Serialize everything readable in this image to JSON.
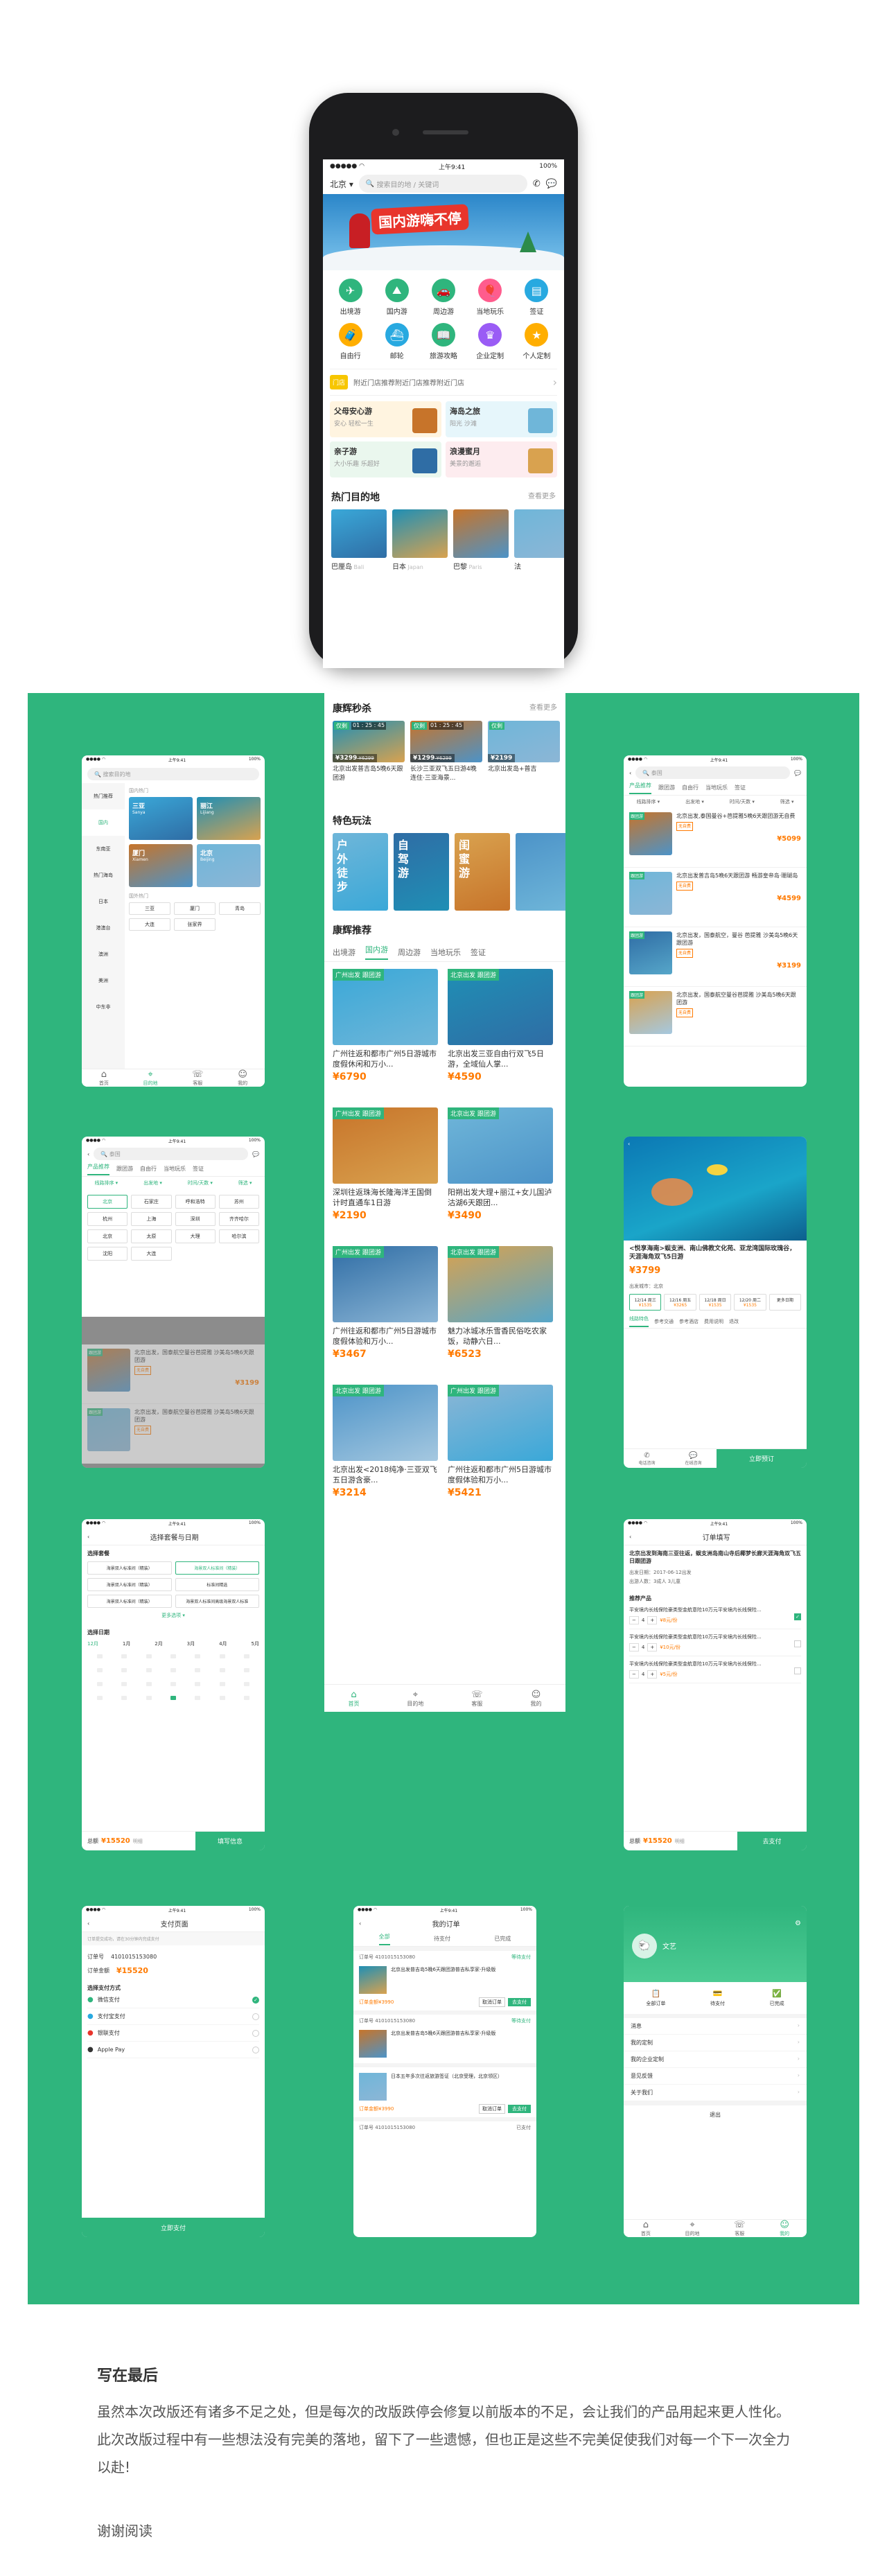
{
  "phone": {
    "status": {
      "time": "上午9:41",
      "battery": "100%"
    },
    "city": "北京",
    "search_placeholder": "搜索目的地 / 关键词",
    "banner_text": "国内游嗨不停",
    "icons_row1": [
      {
        "label": "出境游",
        "icon": "plane-icon",
        "color": "#2fb57d"
      },
      {
        "label": "国内游",
        "icon": "mountain-icon",
        "color": "#2fb57d"
      },
      {
        "label": "周边游",
        "icon": "car-icon",
        "color": "#2fb57d"
      },
      {
        "label": "当地玩乐",
        "icon": "balloon-icon",
        "color": "#ff5c8d"
      },
      {
        "label": "签证",
        "icon": "visa-icon",
        "color": "#28a9e0"
      }
    ],
    "icons_row2": [
      {
        "label": "自由行",
        "icon": "suitcase-icon",
        "color": "#ffae00"
      },
      {
        "label": "邮轮",
        "icon": "ship-icon",
        "color": "#28a9e0"
      },
      {
        "label": "旅游攻略",
        "icon": "guide-icon",
        "color": "#2fb57d"
      },
      {
        "label": "企业定制",
        "icon": "crown-icon",
        "color": "#9a5cf5"
      },
      {
        "label": "个人定制",
        "icon": "star-icon",
        "color": "#ffae00"
      }
    ],
    "nearby_badge": "门店",
    "nearby_text": "附近门店推荐附近门店推荐附近门店",
    "promos": [
      {
        "title": "父母安心游",
        "sub": "安心 轻松一生"
      },
      {
        "title": "海岛之旅",
        "sub": "阳光 沙滩"
      },
      {
        "title": "亲子游",
        "sub": "大小乐趣 乐超好"
      },
      {
        "title": "浪漫蜜月",
        "sub": "美景的邂逅"
      }
    ],
    "hot_title": "热门目的地",
    "hot_more": "查看更多",
    "hot_places": [
      {
        "cn": "巴厘岛",
        "en": "Bali"
      },
      {
        "cn": "日本",
        "en": "Japan"
      },
      {
        "cn": "巴黎",
        "en": "Paris"
      },
      {
        "cn": "法"
      }
    ]
  },
  "center": {
    "flash_title": "康辉秒杀",
    "flash_more": "查看更多",
    "flash_items": [
      {
        "tag": "仅剩",
        "time": "01 : 25 : 45",
        "price": "¥3299",
        "old": "¥6299",
        "title": "北京出发普吉岛5晚6天跟团游"
      },
      {
        "tag": "仅剩",
        "time": "01 : 25 : 45",
        "price": "¥1299",
        "old": "¥6299",
        "title": "长沙三亚双飞五日游4晚连住·三亚海景..."
      },
      {
        "tag": "仅剩",
        "time": "",
        "price": "¥2199",
        "old": "",
        "title": "北京出发岛+普吉"
      }
    ],
    "special_title": "特色玩法",
    "special_items": [
      "户外徒步",
      "自驾游",
      "闺蜜游",
      ""
    ],
    "recommend_title": "康辉推荐",
    "tabs": [
      "出境游",
      "国内游",
      "周边游",
      "当地玩乐",
      "签证"
    ],
    "active_tab": 1,
    "cards": [
      {
        "tag": "广州出发 跟团游",
        "title": "广州往返和都市广州5日游城市度假休闲和万小...",
        "price": "¥6790"
      },
      {
        "tag": "北京出发 跟团游",
        "title": "北京出发三亚自由行双飞5日游，全域仙人掌...",
        "price": "¥4590"
      },
      {
        "tag": "广州出发 跟团游",
        "title": "深圳往返珠海长隆海洋王国倒计时直通车1日游",
        "price": "¥2190"
      },
      {
        "tag": "北京出发 跟团游",
        "title": "阳朔出发大理+丽江+女儿国泸沽湖6天跟团...",
        "price": "¥3490"
      },
      {
        "tag": "广州出发 跟团游",
        "title": "广州往返和都市广州5日游城市度假体验和万小...",
        "price": "¥3467"
      },
      {
        "tag": "北京出发 跟团游",
        "title": "魅力冰城冰乐雪香民俗吃农家饭，动静六日...",
        "price": "¥6523"
      },
      {
        "tag": "北京出发 跟团游",
        "title": "北京出发<2018纯净·三亚双飞五日游含豪...",
        "price": "¥3214"
      },
      {
        "tag": "广州出发 跟团游",
        "title": "广州往返和都市广州5日游城市度假体验和万小...",
        "price": "¥5421"
      }
    ],
    "tabbar": [
      "首页",
      "目的地",
      "客服",
      "我的"
    ]
  },
  "m1": {
    "search": "搜索目的地",
    "side": [
      "热门推荐",
      "国内",
      "东南亚",
      "热门海岛",
      "日本",
      "港澳台",
      "澳洲",
      "美洲",
      "中东非"
    ],
    "domestic_label": "国内热门",
    "places": [
      {
        "cn": "三亚",
        "en": "Sanya"
      },
      {
        "cn": "丽江",
        "en": "Lijiang"
      },
      {
        "cn": "厦门",
        "en": "Xiamen"
      },
      {
        "cn": "北京",
        "en": "Beijing"
      }
    ],
    "chips_label": "国外热门",
    "chips": [
      "三亚",
      "厦门",
      "青岛",
      "大连",
      "张家界"
    ]
  },
  "m2": {
    "search": "泰国",
    "tabs": [
      "产品推荐",
      "跟团游",
      "自由行",
      "当地玩乐",
      "签证"
    ],
    "filters": [
      "线路排序",
      "出发地",
      "时间/天数",
      "筛选"
    ],
    "items": [
      {
        "title": "北京出发,泰国曼谷+芭提雅5晚6天跟团游无自费",
        "price": "¥5099"
      },
      {
        "title": "北京出发普吉岛5晚6天跟团游 畅游皇帝岛·珊瑚岛",
        "price": "¥4599"
      },
      {
        "title": "北京出发，国泰航空，曼谷 芭提雅 沙美岛5晚6天跟团游",
        "price": "¥3199"
      },
      {
        "title": "北京出发，国泰航空曼谷芭提雅 沙美岛5晚6天跟团游",
        "price": ""
      }
    ],
    "tag": "跟团游",
    "note": "无自费"
  },
  "m3": {
    "search": "泰国",
    "tabs": [
      "产品推荐",
      "跟团游",
      "自由行",
      "当地玩乐",
      "签证"
    ],
    "filters": [
      "线路排序",
      "出发地",
      "时间/天数",
      "筛选"
    ],
    "cities": [
      "北京",
      "石家庄",
      "呼和浩特",
      "苏州",
      "杭州",
      "上海",
      "深圳",
      "齐齐哈尔",
      "北京",
      "太原",
      "大理",
      "哈尔滨",
      "沈阳",
      "大连"
    ],
    "items": [
      {
        "title": "北京出发，国泰航空曼谷芭提雅 沙美岛5晚6天跟团游",
        "price": "¥3199"
      },
      {
        "title": "北京出发，国泰航空曼谷芭提雅 沙美岛5晚6天跟团游",
        "price": ""
      }
    ]
  },
  "m4": {
    "title": "<悦享海南>蜈支洲、南山佛教文化苑、亚龙湾国际玫瑰谷，天涯海角双飞5日游",
    "price": "¥3799",
    "departure": "出发城市：北京",
    "dates": [
      "12/14 周三",
      "12/16 周五",
      "12/18 周日",
      "12/20 周二",
      "更多日期"
    ],
    "date_prices": [
      "¥1535",
      "¥3265",
      "¥1535",
      "¥1535"
    ],
    "tabs": [
      "线路特色",
      "参考交通",
      "参考酒店",
      "费用说明",
      "退改"
    ],
    "btn": "立即预订",
    "bottom": [
      "电话咨询",
      "在线咨询"
    ]
  },
  "m5": {
    "header": "选择套餐与日期",
    "pkg_label": "选择套餐",
    "pkgs": [
      "海景双人标准间（精装）",
      "海景双人标准间（精装）",
      "海景双人标准间（精装）",
      "标准间精选",
      "海景双人标准间（精装）",
      "海景双人标准间高级海景双人标准"
    ],
    "more": "更多选项 ▾",
    "date_label": "选择日期",
    "months": [
      "12月",
      "1月",
      "2月",
      "3月",
      "4月",
      "5月"
    ],
    "total_label": "总额",
    "total": "¥15520",
    "detail": "明细",
    "btn": "填写信息"
  },
  "m6": {
    "header": "订单填写",
    "title": "北京出发到海南三亚往返，蜈支洲岛南山寺后椰梦长廊天涯海角双飞五日跟团游",
    "date": "出发日期：2017-06-12出发",
    "people": "出游人数：3成人 3儿童",
    "ins_label": "推荐产品",
    "ins": [
      {
        "t": "平安境内长线保险豪类型金航意险10万元平安境内长线保险...",
        "p": "¥8元/份"
      },
      {
        "t": "平安境内长线保险豪类型金航意险10万元平安境内长线保险...",
        "p": "¥10元/份"
      },
      {
        "t": "平安境内长线保险豪类型金航意险10万元平安境内长线保险...",
        "p": "¥5元/份"
      }
    ],
    "total_label": "总额",
    "total": "¥15520",
    "detail": "明细",
    "btn": "去支付"
  },
  "m7": {
    "header": "支付页面",
    "notice": "订单提交成功，请在30分钟内完成支付",
    "order_label": "订单号",
    "order_no": "4101015153080",
    "amount_label": "订单金额",
    "amount": "¥15520",
    "method_label": "选择支付方式",
    "methods": [
      "微信支付",
      "支付宝支付",
      "银联支付",
      "Apple Pay"
    ],
    "btn": "立即支付"
  },
  "m8": {
    "header": "我的订单",
    "tabs": [
      "全部",
      "待支付",
      "已完成"
    ],
    "orders": [
      {
        "no": "订单号 4101015153080",
        "status": "等待支付",
        "title": "北京出发普吉岛5晚6天跟团游普吉私享家-升级版",
        "amount": "订单金额¥3990",
        "b1": "取消订单",
        "b2": "去支付"
      },
      {
        "no": "订单号 4101015153080",
        "status": "等待支付",
        "title": "北京出发普吉岛5晚6天跟团游普吉私享家-升级版",
        "amount": "",
        "b1": "",
        "b2": ""
      },
      {
        "no": "",
        "status": "",
        "title": "日本五年多次往返旅游签证（北京受理，北京领区）",
        "amount": "订单金额¥3990",
        "b1": "取消订单",
        "b2": "去支付"
      }
    ],
    "last": "订单号 4101015153080",
    "last_status": "已支付"
  },
  "m9": {
    "name": "文艺",
    "quick": [
      "全部订单",
      "待支付",
      "已完成"
    ],
    "list": [
      "消息",
      "我的定制",
      "我的企业定制",
      "意见反馈",
      "关于我们"
    ],
    "logout": "退出",
    "tabbar": [
      "首页",
      "目的地",
      "客服",
      "我的"
    ]
  },
  "closing": {
    "title": "写在最后",
    "body": "虽然本次改版还有诸多不足之处，但是每次的改版跌停会修复以前版本的不足，会让我们的产品用起来更人性化。此次改版过程中有一些想法没有完美的落地，留下了一些遗憾，但也正是这些不完美促使我们对每一个下一次全力以赴!",
    "thanks": "谢谢阅读"
  }
}
